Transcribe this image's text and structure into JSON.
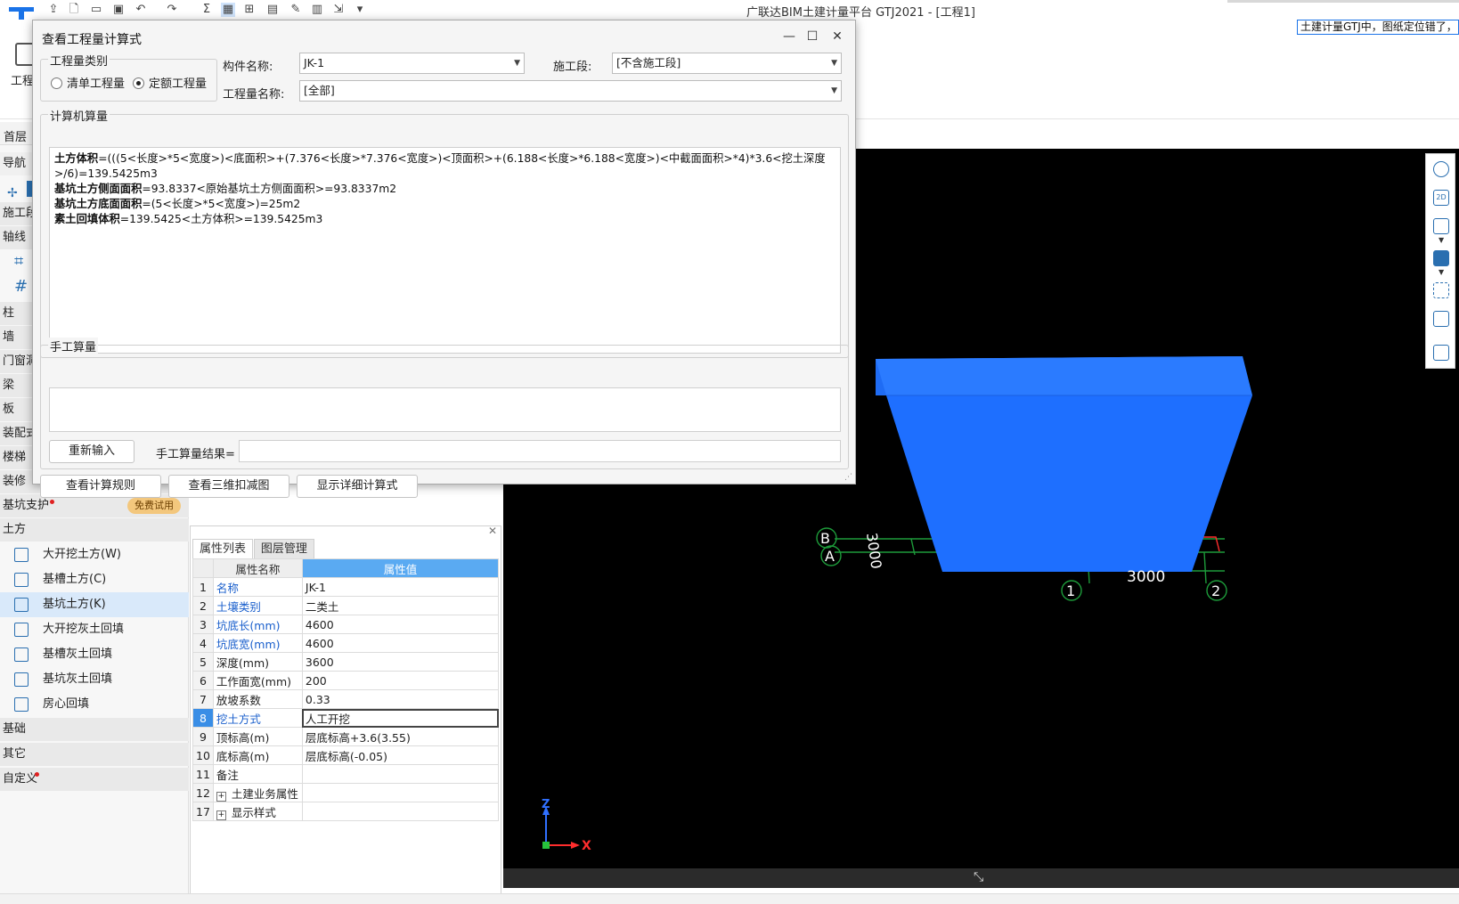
{
  "app": {
    "title": "广联达BIM土建计量平台 GTJ2021 - [工程1]",
    "notice": "土建计量GTJ中，图纸定位错了，",
    "ribbon_label": "工程",
    "floor_label": "首层"
  },
  "colors": {
    "accent": "#1a73e8",
    "pit_blue": "#1e6fff",
    "grid_green": "#1d9b3a",
    "axis_blue": "#3070ff",
    "axis_red": "#ff2d2d"
  },
  "leftnav": {
    "sections_top": [
      "导航",
      "施工段",
      "轴线",
      "柱",
      "墙",
      "门窗洞",
      "梁",
      "板",
      "装配式",
      "楼梯",
      "装修"
    ],
    "support": {
      "label": "基坑支护",
      "badge": "免费试用"
    },
    "earth": {
      "label": "土方",
      "items": [
        "大开挖土方(W)",
        "基槽土方(C)",
        "基坑土方(K)",
        "大开挖灰土回填",
        "基槽灰土回填",
        "基坑灰土回填",
        "房心回填"
      ],
      "selected_index": 2
    },
    "sections_bottom": [
      "基础",
      "其它",
      "自定义"
    ]
  },
  "properties": {
    "tabs": [
      "属性列表",
      "图层管理"
    ],
    "headers": [
      "属性名称",
      "属性值"
    ],
    "rows": [
      {
        "idx": "1",
        "name": "名称",
        "value": "JK-1",
        "blue": true
      },
      {
        "idx": "2",
        "name": "土壤类别",
        "value": "二类土",
        "blue": true
      },
      {
        "idx": "3",
        "name": "坑底长(mm)",
        "value": "4600",
        "blue": true
      },
      {
        "idx": "4",
        "name": "坑底宽(mm)",
        "value": "4600",
        "blue": true
      },
      {
        "idx": "5",
        "name": "深度(mm)",
        "value": "3600",
        "blue": false
      },
      {
        "idx": "6",
        "name": "工作面宽(mm)",
        "value": "200",
        "blue": false
      },
      {
        "idx": "7",
        "name": "放坡系数",
        "value": "0.33",
        "blue": false
      },
      {
        "idx": "8",
        "name": "挖土方式",
        "value": "人工开挖",
        "blue": true,
        "selected": true
      },
      {
        "idx": "9",
        "name": "顶标高(m)",
        "value": "层底标高+3.6(3.55)",
        "blue": false
      },
      {
        "idx": "10",
        "name": "底标高(m)",
        "value": "层底标高(-0.05)",
        "blue": false
      },
      {
        "idx": "11",
        "name": "备注",
        "value": "",
        "blue": false
      },
      {
        "idx": "12",
        "name": "土建业务属性",
        "value": "",
        "blue": false,
        "expandable": true
      },
      {
        "idx": "17",
        "name": "显示样式",
        "value": "",
        "blue": false,
        "expandable": true
      }
    ]
  },
  "view3d": {
    "grid_labels": {
      "axis_b": "B",
      "axis_a": "A",
      "axis_1": "1",
      "axis_2": "2"
    },
    "dim_vertical": "3000",
    "dim_horizontal": "3000",
    "axis_z": "Z",
    "axis_x": "X"
  },
  "dialog": {
    "title": "查看工程量计算式",
    "qty_group": "工程量类别",
    "radio_list": "清单工程量",
    "radio_quota": "定额工程量",
    "radio_selected": "定额工程量",
    "component_label": "构件名称:",
    "component_value": "JK-1",
    "segment_label": "施工段:",
    "segment_value": "[不含施工段]",
    "qtyname_label": "工程量名称:",
    "qtyname_value": "[全部]",
    "computer_group": "计算机算量",
    "formulas": [
      {
        "name": "土方体积",
        "expr": "=(((5<长度>*5<宽度>)<底面积>+(7.376<长度>*7.376<宽度>)<顶面积>+(6.188<长度>*6.188<宽度>)<中截面面积>*4)*3.6<挖土深度>/6)=139.5425m3"
      },
      {
        "name": "基坑土方侧面面积",
        "expr": "=93.8337<原始基坑土方侧面面积>=93.8337m2"
      },
      {
        "name": "基坑土方底面面积",
        "expr": "=(5<长度>*5<宽度>)=25m2"
      },
      {
        "name": "素土回填体积",
        "expr": "=139.5425<土方体积>=139.5425m3"
      }
    ],
    "manual_group": "手工算量",
    "reenter_button": "重新输入",
    "manual_result_label": "手工算量结果=",
    "manual_result_value": "",
    "btn_rules": "查看计算规则",
    "btn_3d": "查看三维扣减图",
    "btn_detail": "显示详细计算式"
  }
}
